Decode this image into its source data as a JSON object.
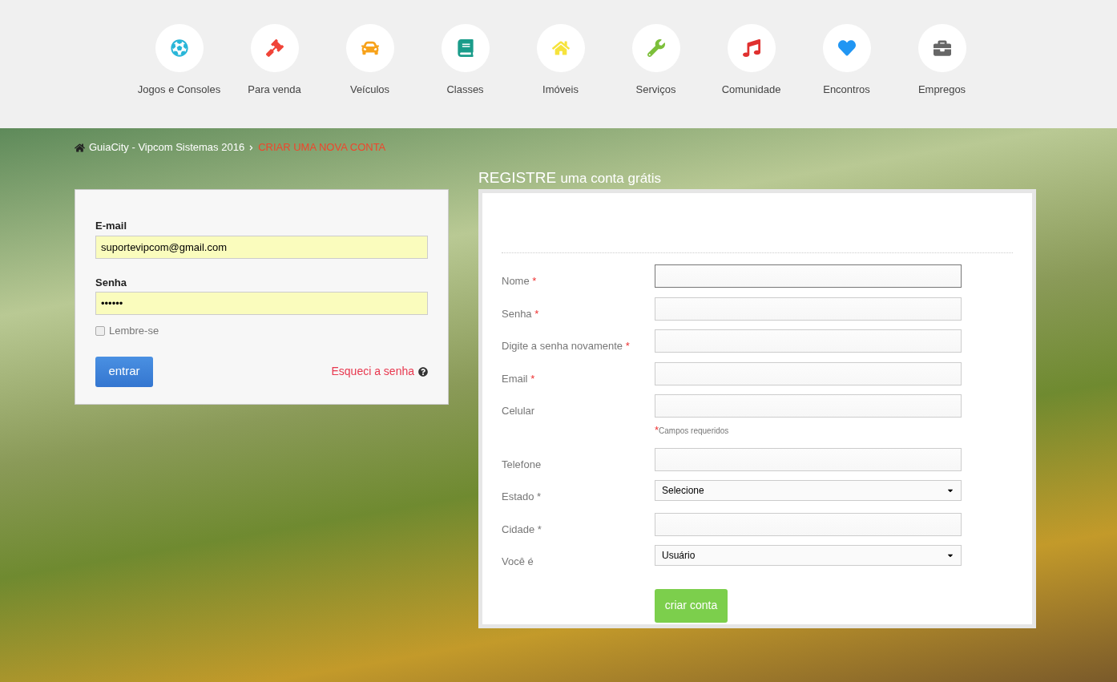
{
  "categories": [
    {
      "label": "Jogos e Consoles",
      "kind": "ball",
      "color": "#29b6d8"
    },
    {
      "label": "Para venda",
      "kind": "gavel",
      "color": "#f04438"
    },
    {
      "label": "Veículos",
      "kind": "car",
      "color": "#f7a21b"
    },
    {
      "label": "Classes",
      "kind": "book",
      "color": "#1a9c8a"
    },
    {
      "label": "Imóveis",
      "kind": "home",
      "color": "#f6e33c"
    },
    {
      "label": "Serviços",
      "kind": "wrench",
      "color": "#7cbf3a"
    },
    {
      "label": "Comunidade",
      "kind": "music",
      "color": "#e0302f"
    },
    {
      "label": "Encontros",
      "kind": "heart",
      "color": "#2196f3"
    },
    {
      "label": "Empregos",
      "kind": "briefcase",
      "color": "#666666"
    }
  ],
  "breadcrumb": {
    "home": "GuiaCity - Vipcom Sistemas 2016",
    "current": "CRIAR UMA NOVA CONTA"
  },
  "login": {
    "fields": [
      {
        "label": "E-mail",
        "value": "suportevipcom@gmail.com",
        "autofilled": true
      },
      {
        "label": "Senha",
        "value": "••••••",
        "autofilled": true
      }
    ],
    "remember": {
      "label": "Lembre-se",
      "checked": false
    },
    "submit": "entrar",
    "forgot": "Esqueci a senha"
  },
  "register": {
    "title_bold": "REGISTRE",
    "title_rest": "uma conta grátis",
    "required_mark": "*",
    "fields": [
      {
        "kind": "text",
        "label": "Nome",
        "required": true,
        "focused": true
      },
      {
        "kind": "text",
        "label": "Senha",
        "required": true,
        "focused": false
      },
      {
        "kind": "text",
        "label": "Digite a senha novamente",
        "required": true,
        "focused": false
      },
      {
        "kind": "text",
        "label": "Email",
        "required": true,
        "focused": false
      },
      {
        "kind": "text",
        "label": "Celular",
        "required": false,
        "focused": false,
        "note": "Campos requeridos"
      },
      {
        "kind": "text",
        "label": "Telefone",
        "required": false,
        "focused": false
      },
      {
        "kind": "select",
        "label": "Estado *",
        "required": false,
        "value": "Selecione"
      },
      {
        "kind": "text",
        "label": "Cidade *",
        "required": false,
        "focused": false
      },
      {
        "kind": "select",
        "label": "Você é",
        "required": false,
        "value": "Usuário"
      }
    ],
    "submit": "criar conta"
  }
}
